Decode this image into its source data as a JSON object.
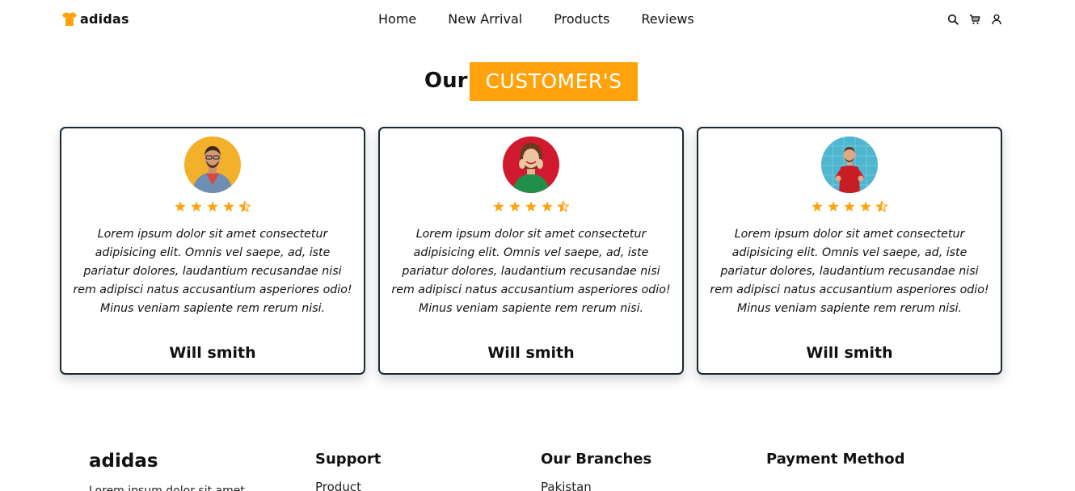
{
  "nav": {
    "logo_text": "adidas",
    "menu": [
      "Home",
      "New Arrival",
      "Products",
      "Reviews"
    ],
    "icons": [
      "search-icon",
      "cart-icon",
      "user-icon"
    ]
  },
  "heading": {
    "our": "Our",
    "highlight": "CUSTOMER'S"
  },
  "reviews": [
    {
      "quote": "Lorem ipsum dolor sit amet consectetur adipisicing elit. Omnis vel saepe, ad, iste pariatur dolores, laudantium recusandae nisi rem adipisci natus accusantium asperiores odio! Minus veniam sapiente rem rerum nisi.",
      "author": "Will smith",
      "rating": 4.5
    },
    {
      "quote": "Lorem ipsum dolor sit amet consectetur adipisicing elit. Omnis vel saepe, ad, iste pariatur dolores, laudantium recusandae nisi rem adipisci natus accusantium asperiores odio! Minus veniam sapiente rem rerum nisi.",
      "author": "Will smith",
      "rating": 4.5
    },
    {
      "quote": "Lorem ipsum dolor sit amet consectetur adipisicing elit. Omnis vel saepe, ad, iste pariatur dolores, laudantium recusandae nisi rem adipisci natus accusantium asperiores odio! Minus veniam sapiente rem rerum nisi.",
      "author": "Will smith",
      "rating": 4.5
    }
  ],
  "footer": {
    "brand": "adidas",
    "brand_sub": "Lorem ipsum dolor sit amet",
    "columns": [
      "Support",
      "Our Branches",
      "Payment Method"
    ],
    "support_first": "Product",
    "branches_first": "Pakistan"
  },
  "colors": {
    "accent": "#ffa20c",
    "text": "#111111",
    "card_border": "#1a2a33"
  }
}
